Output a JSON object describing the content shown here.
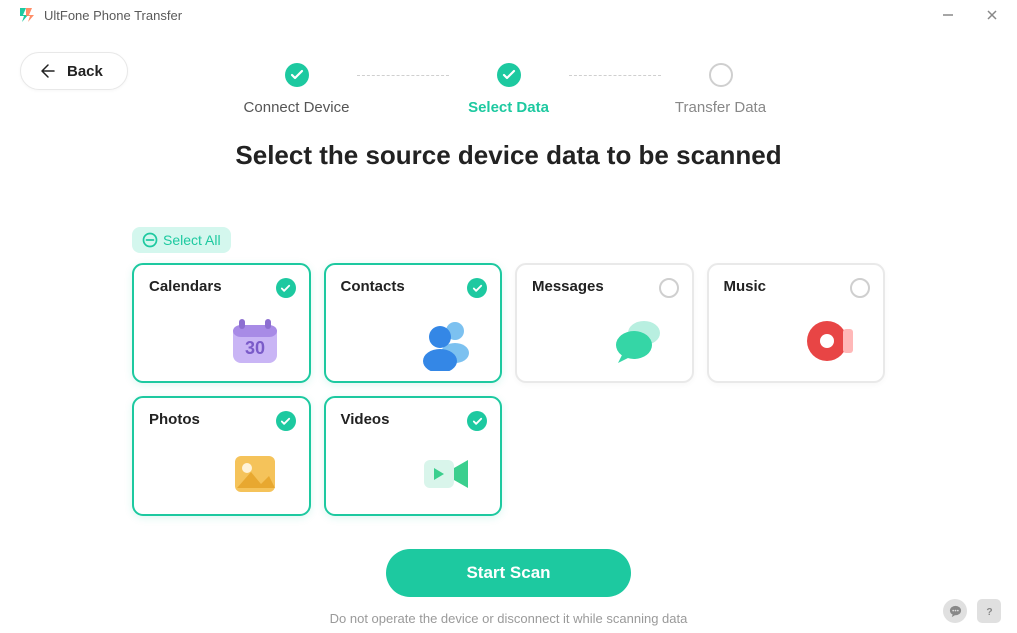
{
  "app": {
    "title": "UltFone Phone Transfer"
  },
  "back": {
    "label": "Back"
  },
  "stepper": {
    "steps": [
      {
        "label": "Connect Device",
        "state": "done"
      },
      {
        "label": "Select Data",
        "state": "active"
      },
      {
        "label": "Transfer Data",
        "state": "pending"
      }
    ]
  },
  "heading": "Select the source device data to be scanned",
  "selectAll": {
    "label": "Select All"
  },
  "categories": [
    {
      "key": "calendars",
      "label": "Calendars",
      "selected": true,
      "icon": "calendar-icon"
    },
    {
      "key": "contacts",
      "label": "Contacts",
      "selected": true,
      "icon": "contacts-icon"
    },
    {
      "key": "messages",
      "label": "Messages",
      "selected": false,
      "icon": "messages-icon"
    },
    {
      "key": "music",
      "label": "Music",
      "selected": false,
      "icon": "music-icon"
    },
    {
      "key": "photos",
      "label": "Photos",
      "selected": true,
      "icon": "photos-icon"
    },
    {
      "key": "videos",
      "label": "Videos",
      "selected": true,
      "icon": "videos-icon"
    }
  ],
  "action": {
    "scan_label": "Start Scan",
    "hint": "Do not operate the device or disconnect it while scanning data"
  },
  "colors": {
    "accent": "#1dc9a0"
  }
}
